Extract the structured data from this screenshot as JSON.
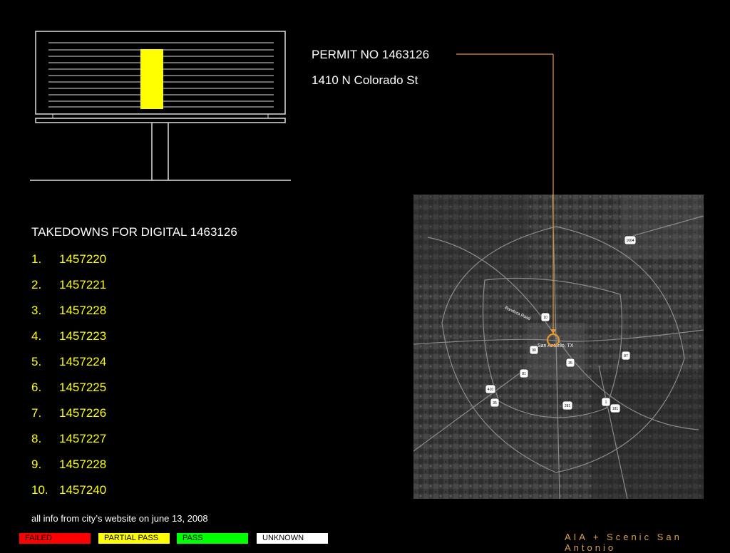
{
  "permit": {
    "number_label": "PERMIT NO 1463126",
    "address": "1410 N Colorado St"
  },
  "takedowns": {
    "title": "TAKEDOWNS FOR DIGITAL 1463126",
    "items": [
      {
        "num": "1.",
        "value": "1457220"
      },
      {
        "num": "2.",
        "value": "1457221"
      },
      {
        "num": "3.",
        "value": "1457228"
      },
      {
        "num": "4.",
        "value": "1457223"
      },
      {
        "num": "5.",
        "value": "1457224"
      },
      {
        "num": "6.",
        "value": "1457225"
      },
      {
        "num": "7.",
        "value": "1457226"
      },
      {
        "num": "8.",
        "value": "1457227"
      },
      {
        "num": "9.",
        "value": "1457228"
      },
      {
        "num": "10.",
        "value": "1457240"
      }
    ]
  },
  "note": "all info from city’s website on june 13, 2008",
  "legend": {
    "failed": "FAILED",
    "partial_pass": "PARTIAL PASS",
    "pass": "PASS",
    "unknown": "UNKNOWN"
  },
  "brand": "AIA + Scenic San Antonio",
  "map": {
    "city_label": "San Antonio, TX",
    "road_label": "Bandera Road",
    "shields": [
      "1604",
      "10",
      "90",
      "35",
      "87",
      "81",
      "410",
      "35",
      "281",
      "1",
      "181"
    ]
  },
  "colors": {
    "accent": "#e8962e",
    "highlight": "#ffff00",
    "failed": "#ff0000",
    "pass": "#00ff00"
  }
}
